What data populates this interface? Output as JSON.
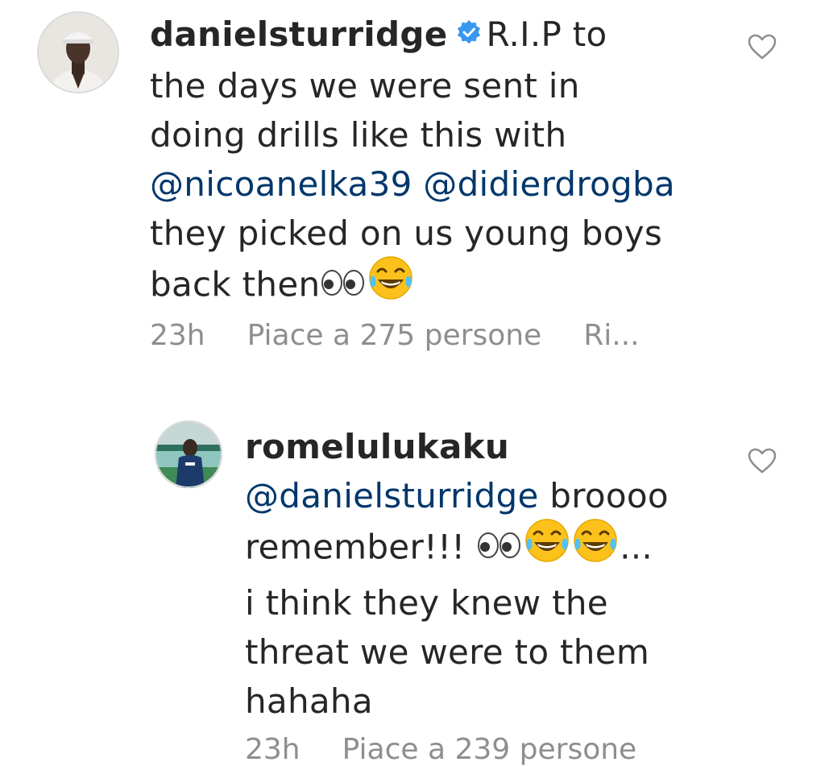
{
  "comments": [
    {
      "username": "danielsturridge",
      "verified": true,
      "lines": [
        {
          "text": "R.I.P to"
        },
        {
          "text": "the days we were sent in"
        },
        {
          "text": "doing drills like this with"
        },
        {
          "mention1": "@nicoanelka39",
          "mention2": "@didierdrogba"
        },
        {
          "text": "they picked on us young boys"
        },
        {
          "text": "back then"
        }
      ],
      "time": "23h",
      "likes": "Piace a 275 persone",
      "reply": "Ri..."
    },
    {
      "username": "romelulukaku",
      "verified": false,
      "mention": "@danielsturridge",
      "lines": [
        {
          "text": "broooo"
        },
        {
          "text": "remember!!! "
        },
        {
          "text": "..."
        },
        {
          "text": "i think they knew the"
        },
        {
          "text": "threat we were to them"
        },
        {
          "text": "hahaha"
        }
      ],
      "time": "23h",
      "likes": "Piace a 239 persone"
    }
  ]
}
